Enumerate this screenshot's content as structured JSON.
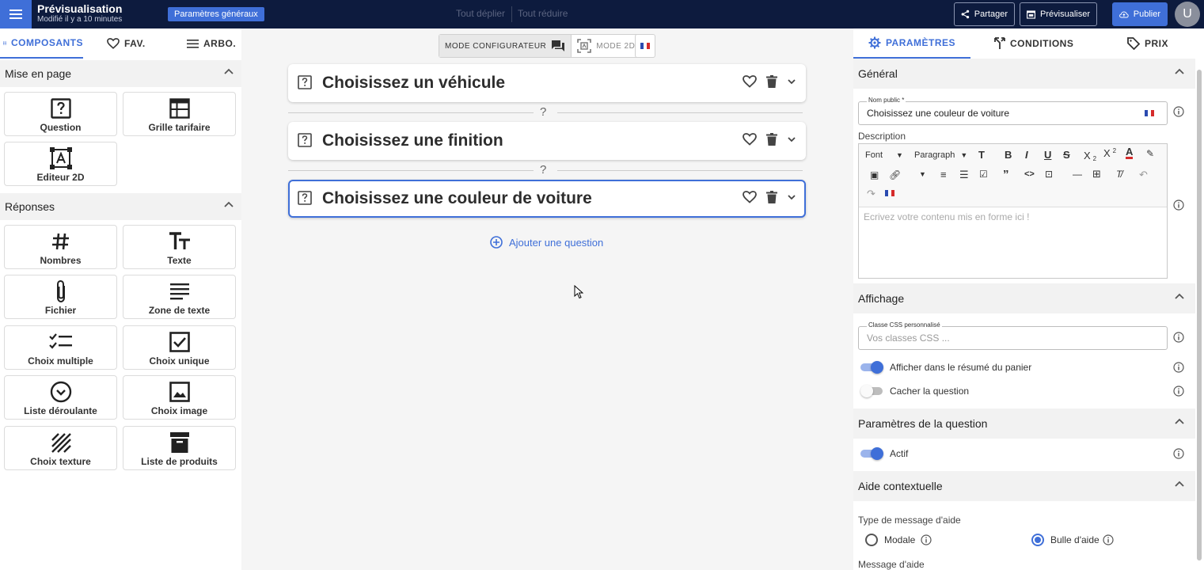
{
  "app": {
    "title": "Prévisualisation",
    "subtitle": "Modifié il y a 10 minutes",
    "general_params": "Paramètres généraux",
    "expand_all": "Tout déplier",
    "collapse_all": "Tout réduire",
    "share": "Partager",
    "preview": "Prévisualiser",
    "publish": "Publier",
    "avatar_initial": "U"
  },
  "left_tabs": {
    "components": "COMPOSANTS",
    "fav": "FAV.",
    "tree": "ARBO."
  },
  "layout_section": {
    "title": "Mise en page",
    "tiles": [
      {
        "label": "Question",
        "icon": "question-box-icon"
      },
      {
        "label": "Grille tarifaire",
        "icon": "table-grid-icon"
      },
      {
        "label": "Editeur 2D",
        "icon": "editor-2d-icon"
      }
    ]
  },
  "answers_section": {
    "title": "Réponses",
    "tiles": [
      {
        "label": "Nombres",
        "icon": "hash-icon"
      },
      {
        "label": "Texte",
        "icon": "text-format-icon"
      },
      {
        "label": "Fichier",
        "icon": "paperclip-icon"
      },
      {
        "label": "Zone de texte",
        "icon": "text-lines-icon"
      },
      {
        "label": "Choix multiple",
        "icon": "checklist-icon"
      },
      {
        "label": "Choix unique",
        "icon": "checkbox-icon"
      },
      {
        "label": "Liste déroulante",
        "icon": "dropdown-circle-icon"
      },
      {
        "label": "Choix image",
        "icon": "image-icon"
      },
      {
        "label": "Choix texture",
        "icon": "texture-icon"
      },
      {
        "label": "Liste de produits",
        "icon": "archive-box-icon"
      }
    ]
  },
  "center": {
    "mode_configurator": "MODE CONFIGURATEUR",
    "mode_2d": "MODE 2D",
    "questions": [
      {
        "title": "Choisissez un véhicule"
      },
      {
        "title": "Choisissez une finition"
      },
      {
        "title": "Choisissez une couleur de voiture"
      }
    ],
    "separator_mark": "?",
    "add_question": "Ajouter une question"
  },
  "right_tabs": {
    "settings": "PARAMÈTRES",
    "conditions": "CONDITIONS",
    "price": "PRIX"
  },
  "general": {
    "title": "Général",
    "public_name_label": "Nom public *",
    "public_name_value": "Choisissez une couleur de voiture",
    "description_label": "Description",
    "font_select": "Font",
    "paragraph_select": "Paragraph",
    "editor_placeholder": "Ecrivez votre contenu mis en forme ici !"
  },
  "display": {
    "title": "Affichage",
    "css_label": "Classe CSS personnalisé",
    "css_placeholder": "Vos classes CSS ...",
    "show_in_cart": "Afficher dans le résumé du panier",
    "show_in_cart_on": true,
    "hide_question": "Cacher la question",
    "hide_question_on": false
  },
  "question_params": {
    "title": "Paramètres de la question",
    "active": "Actif",
    "active_on": true
  },
  "help": {
    "title": "Aide contextuelle",
    "type_label": "Type de message d'aide",
    "modal": "Modale",
    "tooltip": "Bulle d'aide",
    "selected": "tooltip",
    "message_label": "Message d'aide"
  },
  "colors": {
    "accent": "#3f6fd8",
    "topbar": "#0d1b3e"
  }
}
